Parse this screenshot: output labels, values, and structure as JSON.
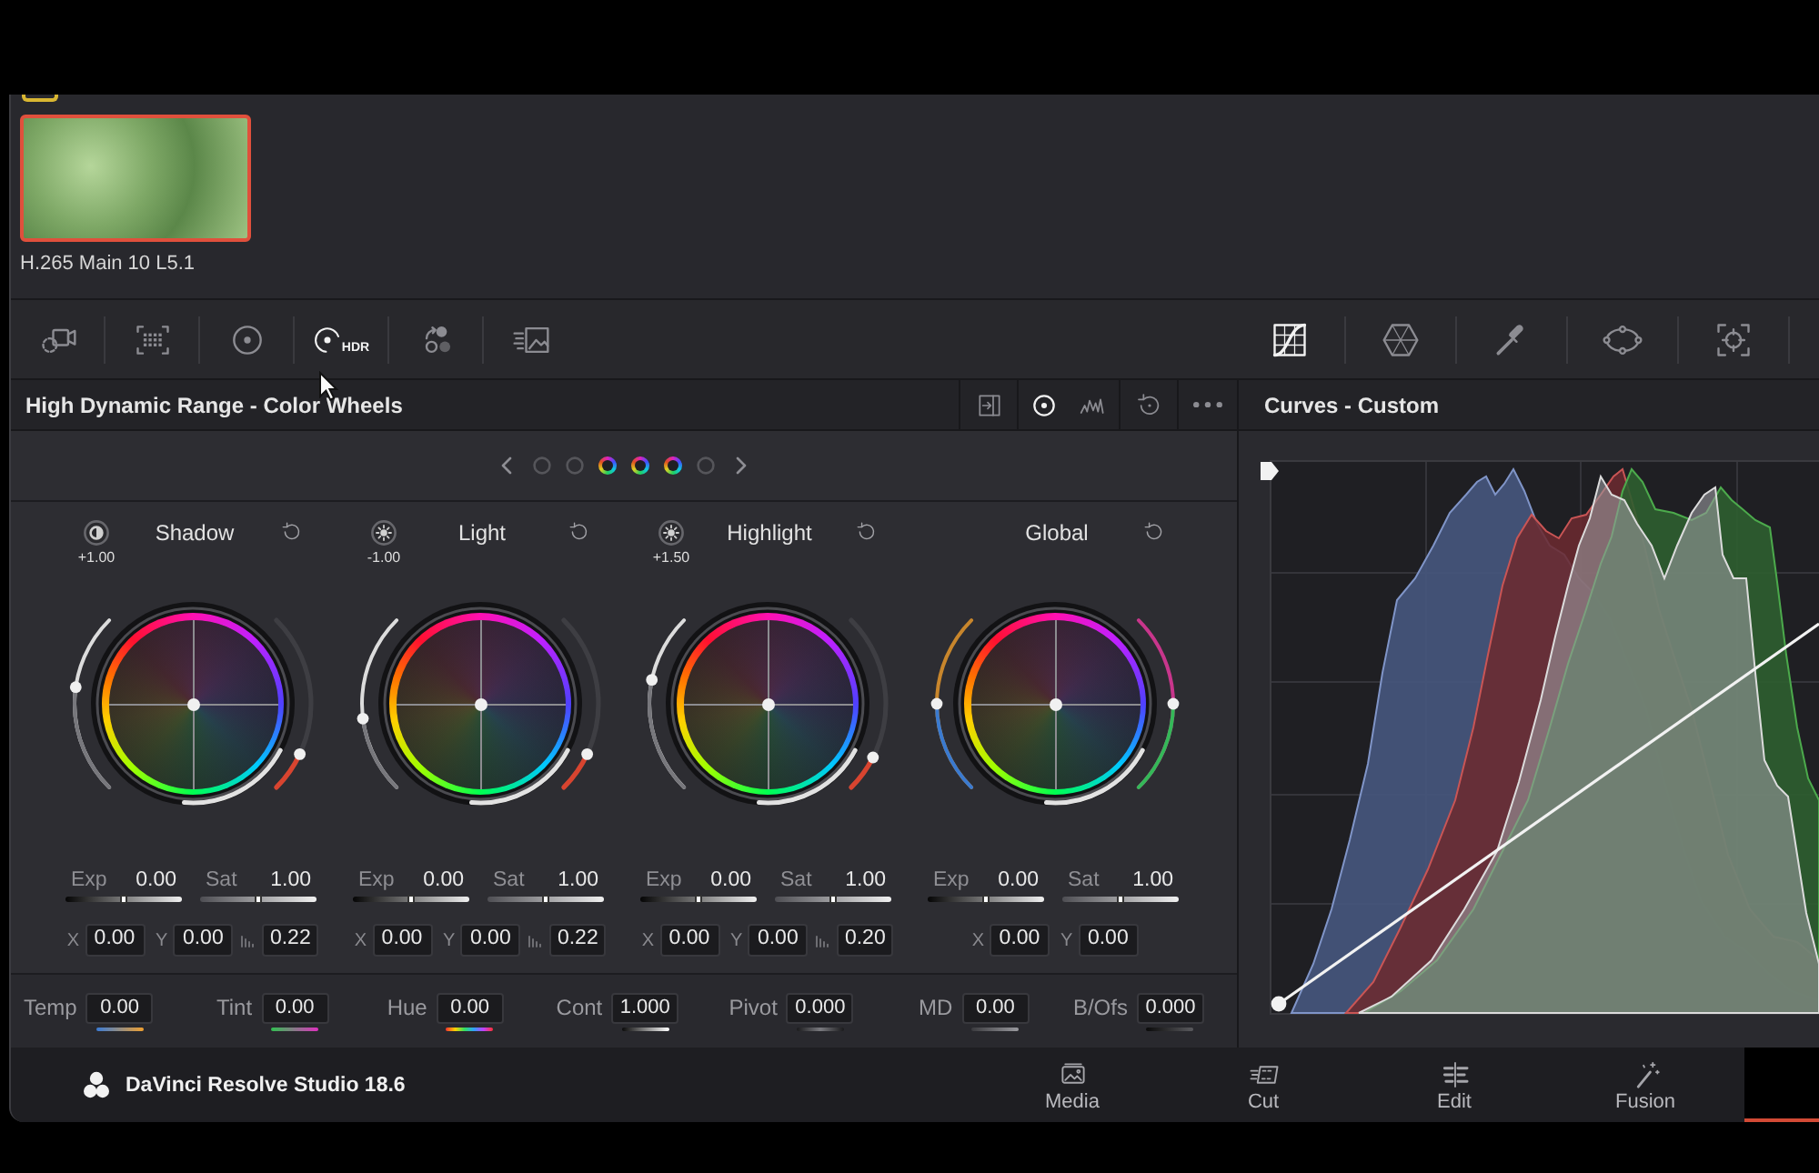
{
  "gallery": {
    "clip": {
      "label": "H.265 Main 10 L5.1",
      "selected": true
    }
  },
  "toolbar": {
    "left_tools": [
      {
        "selected": false
      },
      {
        "selected": false
      },
      {
        "selected": false
      },
      {
        "selected": true,
        "badge": "HDR"
      },
      {
        "selected": false
      },
      {
        "selected": false
      }
    ],
    "right_tools": [
      {
        "selected": true
      },
      {
        "selected": false
      },
      {
        "selected": false
      },
      {
        "selected": false
      },
      {
        "selected": false
      }
    ]
  },
  "hdr_panel": {
    "title": "High Dynamic Range - Color Wheels",
    "header_tools": [
      {
        "selected": false
      },
      {
        "selected": true
      },
      {
        "selected": false
      },
      {
        "selected": false
      },
      {
        "selected": false
      }
    ],
    "pages": [
      {
        "selected": false
      },
      {
        "selected": false
      },
      {
        "selected": true
      },
      {
        "selected": true
      },
      {
        "selected": true
      },
      {
        "selected": false
      }
    ],
    "wheels": [
      {
        "kind": "zone",
        "name": "Shadow",
        "zone_value": "+1.00",
        "left_arc": {
          "level": 0.59
        },
        "right_arc": {
          "level": 0.22
        },
        "exp": {
          "label": "Exp",
          "value": "0.00",
          "level": 0.5
        },
        "sat": {
          "label": "Sat",
          "value": "1.00",
          "level": 0.5
        },
        "x": {
          "label": "X",
          "value": "0.00"
        },
        "y": {
          "label": "Y",
          "value": "0.00"
        },
        "falloff": "0.22"
      },
      {
        "kind": "zone",
        "name": "Light",
        "zone_value": "-1.00",
        "left_arc": {
          "level": 0.42
        },
        "right_arc": {
          "level": 0.22
        },
        "exp": {
          "label": "Exp",
          "value": "0.00",
          "level": 0.5
        },
        "sat": {
          "label": "Sat",
          "value": "1.00",
          "level": 0.5
        },
        "x": {
          "label": "X",
          "value": "0.00"
        },
        "y": {
          "label": "Y",
          "value": "0.00"
        },
        "falloff": "0.22"
      },
      {
        "kind": "zone",
        "name": "Highlight",
        "zone_value": "+1.50",
        "left_arc": {
          "level": 0.63
        },
        "right_arc": {
          "level": 0.2
        },
        "exp": {
          "label": "Exp",
          "value": "0.00",
          "level": 0.5
        },
        "sat": {
          "label": "Sat",
          "value": "1.00",
          "level": 0.5
        },
        "x": {
          "label": "X",
          "value": "0.00"
        },
        "y": {
          "label": "Y",
          "value": "0.00"
        },
        "falloff": "0.20"
      },
      {
        "kind": "global",
        "name": "Global",
        "left_arc": {
          "level": 0.5
        },
        "right_arc": {
          "level": 0.5
        },
        "exp": {
          "label": "Exp",
          "value": "0.00",
          "level": 0.5
        },
        "sat": {
          "label": "Sat",
          "value": "1.00",
          "level": 0.5
        },
        "x": {
          "label": "X",
          "value": "0.00"
        },
        "y": {
          "label": "Y",
          "value": "0.00"
        }
      }
    ],
    "adjustments": [
      {
        "label": "Temp",
        "value": "0.00"
      },
      {
        "label": "Tint",
        "value": "0.00"
      },
      {
        "label": "Hue",
        "value": "0.00"
      },
      {
        "label": "Cont",
        "value": "1.000"
      },
      {
        "label": "Pivot",
        "value": "0.000"
      },
      {
        "label": "MD",
        "value": "0.00"
      },
      {
        "label": "B/Ofs",
        "value": "0.000"
      }
    ]
  },
  "curves_panel": {
    "title": "Curves - Custom"
  },
  "footer": {
    "app_name": "DaVinci Resolve Studio 18.6",
    "pages": [
      {
        "label": "Media",
        "selected": false
      },
      {
        "label": "Cut",
        "selected": false
      },
      {
        "label": "Edit",
        "selected": false
      },
      {
        "label": "Fusion",
        "selected": false
      },
      {
        "selected": true
      }
    ]
  }
}
